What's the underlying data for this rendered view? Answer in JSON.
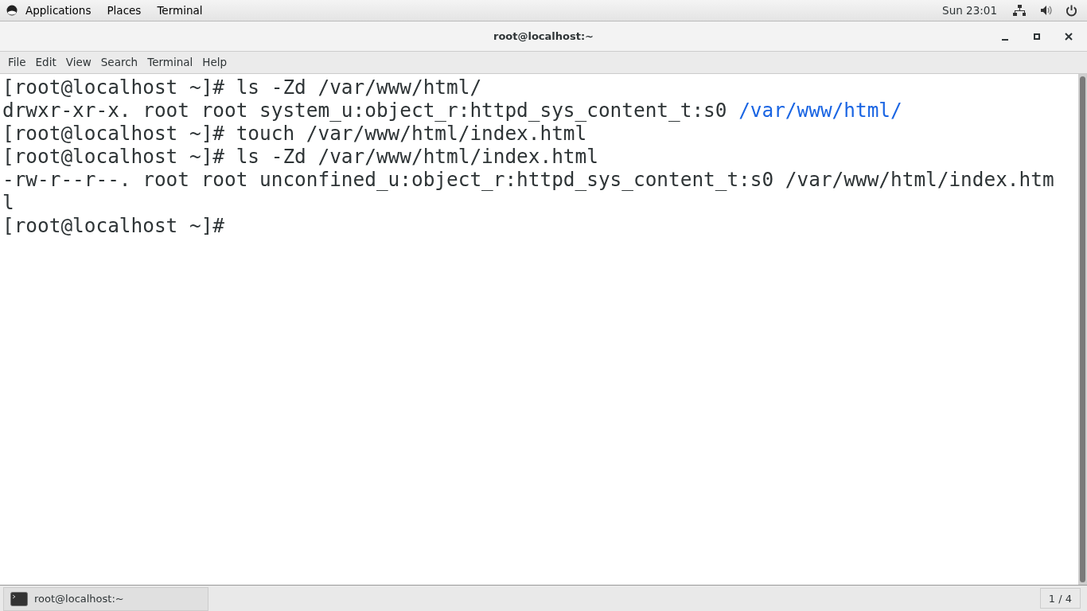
{
  "top_bar": {
    "menus": [
      "Applications",
      "Places",
      "Terminal"
    ],
    "clock": "Sun 23:01"
  },
  "window": {
    "title": "root@localhost:~"
  },
  "menu_bar": [
    "File",
    "Edit",
    "View",
    "Search",
    "Terminal",
    "Help"
  ],
  "terminal": {
    "lines": [
      [
        {
          "kind": "prompt",
          "text": "[root@localhost ~]# ls -Zd /var/www/html/"
        }
      ],
      [
        {
          "kind": "plain",
          "text": "drwxr-xr-x. root root system_u:object_r:httpd_sys_content_t:s0 "
        },
        {
          "kind": "directory",
          "text": "/var/www/html/"
        }
      ],
      [
        {
          "kind": "prompt",
          "text": "[root@localhost ~]# touch /var/www/html/index.html"
        }
      ],
      [
        {
          "kind": "prompt",
          "text": "[root@localhost ~]# ls -Zd /var/www/html/index.html"
        }
      ],
      [
        {
          "kind": "plain",
          "text": "-rw-r--r--. root root unconfined_u:object_r:httpd_sys_content_t:s0 /var/www/html/index.htm"
        }
      ],
      [
        {
          "kind": "plain",
          "text": "l"
        }
      ],
      [
        {
          "kind": "prompt",
          "text": "[root@localhost ~]#"
        }
      ]
    ]
  },
  "taskbar": {
    "windows": [
      {
        "title": "root@localhost:~",
        "selected": false
      }
    ],
    "workspace": "1 / 4"
  }
}
